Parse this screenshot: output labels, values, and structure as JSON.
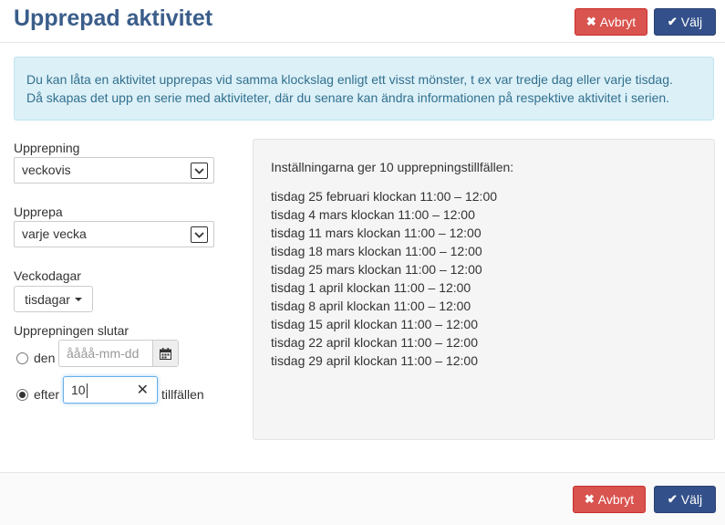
{
  "dialog": {
    "title": "Upprepad aktivitet",
    "cancel_label": "Avbryt",
    "choose_label": "Välj"
  },
  "info": {
    "line1": "Du kan låta en aktivitet upprepas vid samma klockslag enligt ett visst mönster, t ex var tredje dag eller varje tisdag.",
    "line2": "Då skapas det upp en serie med aktiviteter, där du senare kan ändra informationen på respektive aktivitet i serien."
  },
  "form": {
    "repetition_label": "Upprepning",
    "repetition_value": "veckovis",
    "repeat_label": "Upprepa",
    "repeat_value": "varje vecka",
    "weekdays_label": "Veckodagar",
    "weekdays_value": "tisdagar",
    "ends_label": "Upprepningen slutar",
    "on_label": "den",
    "on_date_placeholder": "åååå-mm-dd",
    "on_checked": false,
    "after_label": "efter",
    "after_value": "10",
    "after_checked": true,
    "occurrences_label": "tillfällen"
  },
  "result": {
    "summary": "Inställningarna ger 10 upprepningstillfällen:",
    "occurrences": [
      "tisdag 25 februari klockan 11:00 – 12:00",
      "tisdag 4 mars klockan 11:00 – 12:00",
      "tisdag 11 mars klockan 11:00 – 12:00",
      "tisdag 18 mars klockan 11:00 – 12:00",
      "tisdag 25 mars klockan 11:00 – 12:00",
      "tisdag 1 april klockan 11:00 – 12:00",
      "tisdag 8 april klockan 11:00 – 12:00",
      "tisdag 15 april klockan 11:00 – 12:00",
      "tisdag 22 april klockan 11:00 – 12:00",
      "tisdag 29 april klockan 11:00 – 12:00"
    ]
  },
  "colors": {
    "title": "#3a5d8a",
    "danger": "#d9534f",
    "primary": "#34508a",
    "info_bg": "#dcf0f7",
    "info_text": "#31708f"
  },
  "icons": {
    "cancel": "times-icon",
    "choose": "check-icon",
    "select_arrow": "chevron-down-icon",
    "calendar": "calendar-icon",
    "clear": "clear-icon"
  }
}
